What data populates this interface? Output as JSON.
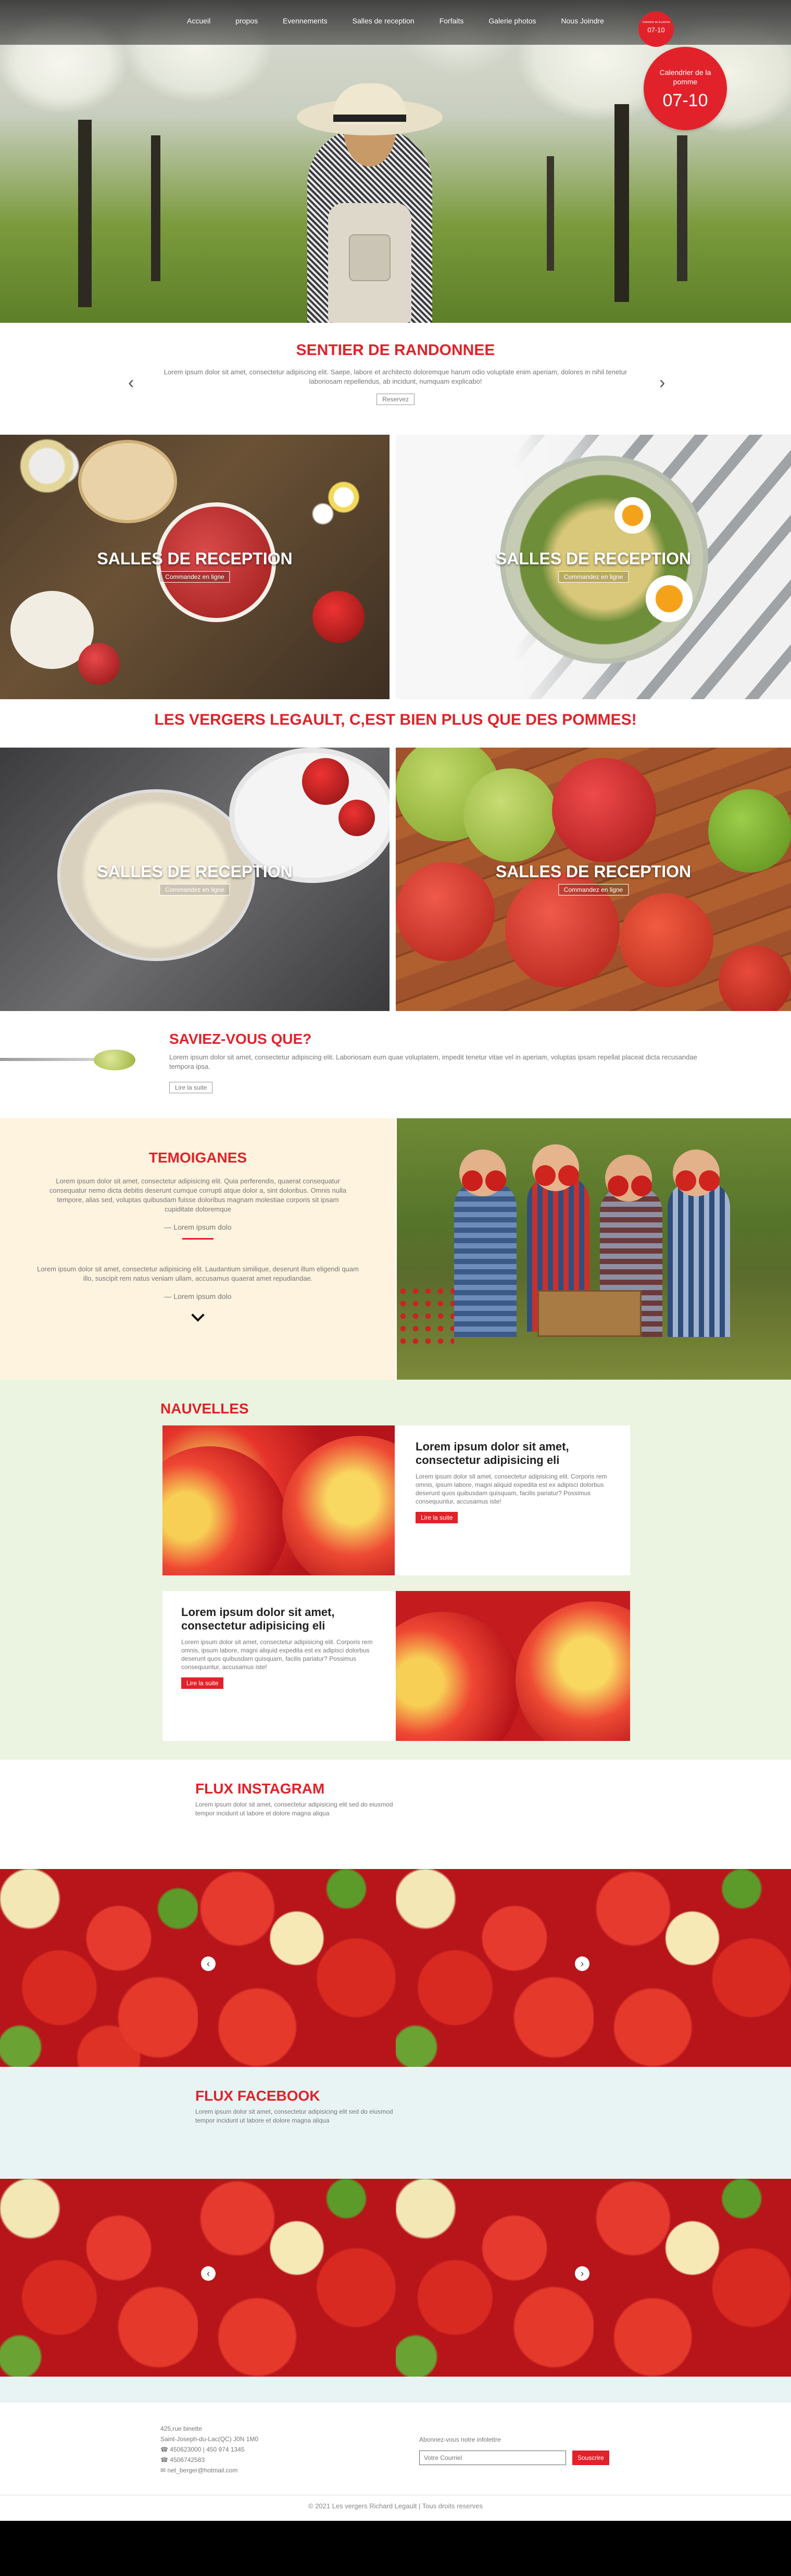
{
  "nav": {
    "items": [
      "Accueil",
      "propos",
      "Evennements",
      "Salles de reception",
      "Forfaits",
      "Galerie photos",
      "Nous Joindre"
    ],
    "badge_small": "07-10",
    "badge_small_top": "Calendrier de la pomme"
  },
  "hero": {
    "badge_label": "Calendrier de la pomme",
    "badge_date": "07-10"
  },
  "slider": {
    "title": "SENTIER DE RANDONNEE",
    "text": "Lorem ipsum dolor sit amet, consectetur adipiscing elit. Saepe, labore et architecto doloremque harum odio voluptate enim aperiam, dolores in nihil tenetur laboriosam repellendus, ab incidunt, numquam explicabo!",
    "button": "Reservez"
  },
  "tiles_top": [
    {
      "title": "SALLES DE RECEPTION",
      "button": "Commandez en ligne"
    },
    {
      "title": "SALLES DE RECEPTION",
      "button": "Commandez en ligne"
    }
  ],
  "tagline": "LES VERGERS LEGAULT, C,EST BIEN PLUS QUE DES POMMES!",
  "tiles_bottom": [
    {
      "title": "SALLES DE RECEPTION",
      "button": "Commandez en ligne"
    },
    {
      "title": "SALLES DE RECEPTION",
      "button": "Commandez en ligne"
    }
  ],
  "saviez": {
    "title": "SAVIEZ-VOUS QUE?",
    "text": "Lorem ipsum dolor sit amet, consectetur adipiscing elit. Laboriosam eum quae voluptatem, impedit tenetur vitae vel in aperiam, voluptas ipsam repellat placeat dicta recusandae tempora ipsa.",
    "button": "Lire la suite"
  },
  "temoignages": {
    "title": "TEMOIGANES",
    "quote1": "Lorem ipsum dolor sit amet, consectetur adipisicing elit. Quia perferendis, quaerat consequatur consequatur nemo dicta debitis deserunt cumque corrupti atque dolor a, sint doloribus. Omnis nulla tempore, alias sed, voluptas quibusdam fuisse doloribus magnam molestiae corporis sit ipsam cupiditate doloremque",
    "author1": "— Lorem ipsum dolo",
    "quote2": "Lorem ipsum dolor sit amet, consectetur adipisicing elit. Laudantium similique, deserunt illum eligendi quam illo, suscipit rem natus veniam ullam, accusamus quaerat amet repudiandae.",
    "author2": "— Lorem ipsum dolo"
  },
  "nouvelles": {
    "title": "NAUVELLES",
    "cards": [
      {
        "title": "Lorem ipsum dolor sit amet, consectetur adipisicing eli",
        "text": "Lorem ipsum dolor sit amet, consectetur adipisicing elit. Corporis rem omnis, ipsum labore, magni aliquid expedita est ex adipisci dolorbus deserunt quos quibusdam quisquam, facilis pariatur? Possimus consequuntur, accusamus iste!",
        "button": "Lire la suite"
      },
      {
        "title": "Lorem ipsum dolor sit amet, consectetur adipisicing eli",
        "text": "Lorem ipsum dolor sit amet, consectetur adipisicing elit. Corporis rem omnis, ipsum labore, magni aliquid expedita est ex adipisci dolorbus deserunt quos quibusdam quisquam, facilis pariatur? Possimus consequuntur, accusamus iste!",
        "button": "Lire la suite"
      }
    ]
  },
  "instagram": {
    "title": "FLUX INSTAGRAM",
    "text": "Lorem ipsum dolor sit amet, consectetur adipisicing elit sed do eiusmod tempor incidunt ut labore et dolore magna aliqua"
  },
  "facebook": {
    "title": "FLUX FACEBOOK",
    "text": "Lorem ipsum dolor sit amet, consectetur adipisicing elit sed do eiusmod tempor incidunt ut labore et dolore magna aliqua"
  },
  "footer": {
    "address1": "425,rue binette",
    "address2": "Saint-Joseph-du-Lac(QC) J0N 1M0",
    "phone1": "450623000 | 450 974 1345",
    "phone2": "4506742583",
    "email": "net_berger@hotmail.com",
    "newsletter_label": "Abonnez-vous notre infolettre",
    "email_placeholder": "Votre Courriel",
    "subscribe": "Souscrire",
    "copyright": "© 2021 Les vergers Richard Legault | Tous droits reserves"
  },
  "colors": {
    "accent": "#e1222a",
    "cream": "#fdf3df",
    "mint": "#eaf4e1",
    "aqua": "#e8f4f3"
  }
}
